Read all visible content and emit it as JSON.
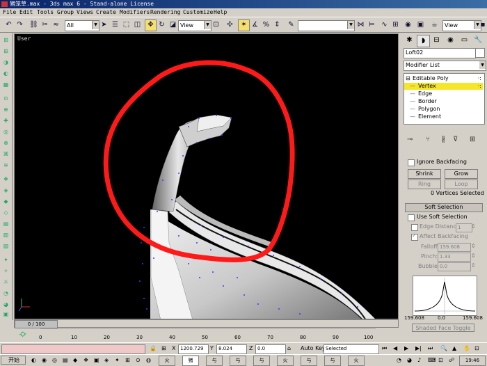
{
  "window": {
    "title": "猪笼草.max - 3ds max 6 - Stand-alone License"
  },
  "menu": [
    "File",
    "Edit",
    "Tools",
    "Group",
    "Views",
    "Create",
    "Modifiers",
    "Rendering",
    "Customize",
    "Help"
  ],
  "toolbar": {
    "selection_filter": "All",
    "ref_coord": "View",
    "named_sel": "",
    "viewport_dd": "View"
  },
  "viewport": {
    "label": "User"
  },
  "command_panel": {
    "object_name": "Loft02",
    "modifier_list": "Modifier List",
    "stack": [
      {
        "label": "Editable Poly",
        "selected": false
      },
      {
        "label": "Vertex",
        "selected": true
      },
      {
        "label": "Edge",
        "selected": false
      },
      {
        "label": "Border",
        "selected": false
      },
      {
        "label": "Polygon",
        "selected": false
      },
      {
        "label": "Element",
        "selected": false
      }
    ],
    "selection": {
      "ignore_backfacing": "Ignore Backfacing",
      "shrink": "Shrink",
      "grow": "Grow",
      "ring": "Ring",
      "loop": "Loop",
      "status": "0 Vertices Selected"
    },
    "soft_selection": {
      "title": "Soft Selection",
      "use_soft": "Use Soft Selection",
      "edge_distance": "Edge Distance:",
      "edge_distance_val": "1",
      "affect_backfacing": "Affect Backfacing",
      "falloff": "Falloff:",
      "falloff_val": "159.608",
      "pinch": "Pinch:",
      "pinch_val": "1.33",
      "bubble": "Bubble:",
      "bubble_val": "0.0",
      "curve_left": "159.608",
      "curve_mid": "0.0",
      "curve_right": "159.608",
      "shaded_toggle": "Shaded Face Toggle"
    }
  },
  "timeline": {
    "frame": "0 / 100",
    "ticks": [
      "0",
      "10",
      "20",
      "30",
      "40",
      "50",
      "60",
      "70",
      "80",
      "90",
      "100"
    ]
  },
  "status": {
    "x_label": "X",
    "x": "1200.729",
    "y_label": "Y",
    "y": "8.024",
    "z_label": "Z",
    "z": "0.0",
    "auto_key": "Auto Key",
    "selected": "Selected"
  },
  "taskbar": {
    "start": "开始",
    "tasks": [
      "火",
      "猪",
      "与",
      "与",
      "与",
      "火",
      "与",
      "与",
      "火"
    ],
    "clock": "19:46"
  }
}
